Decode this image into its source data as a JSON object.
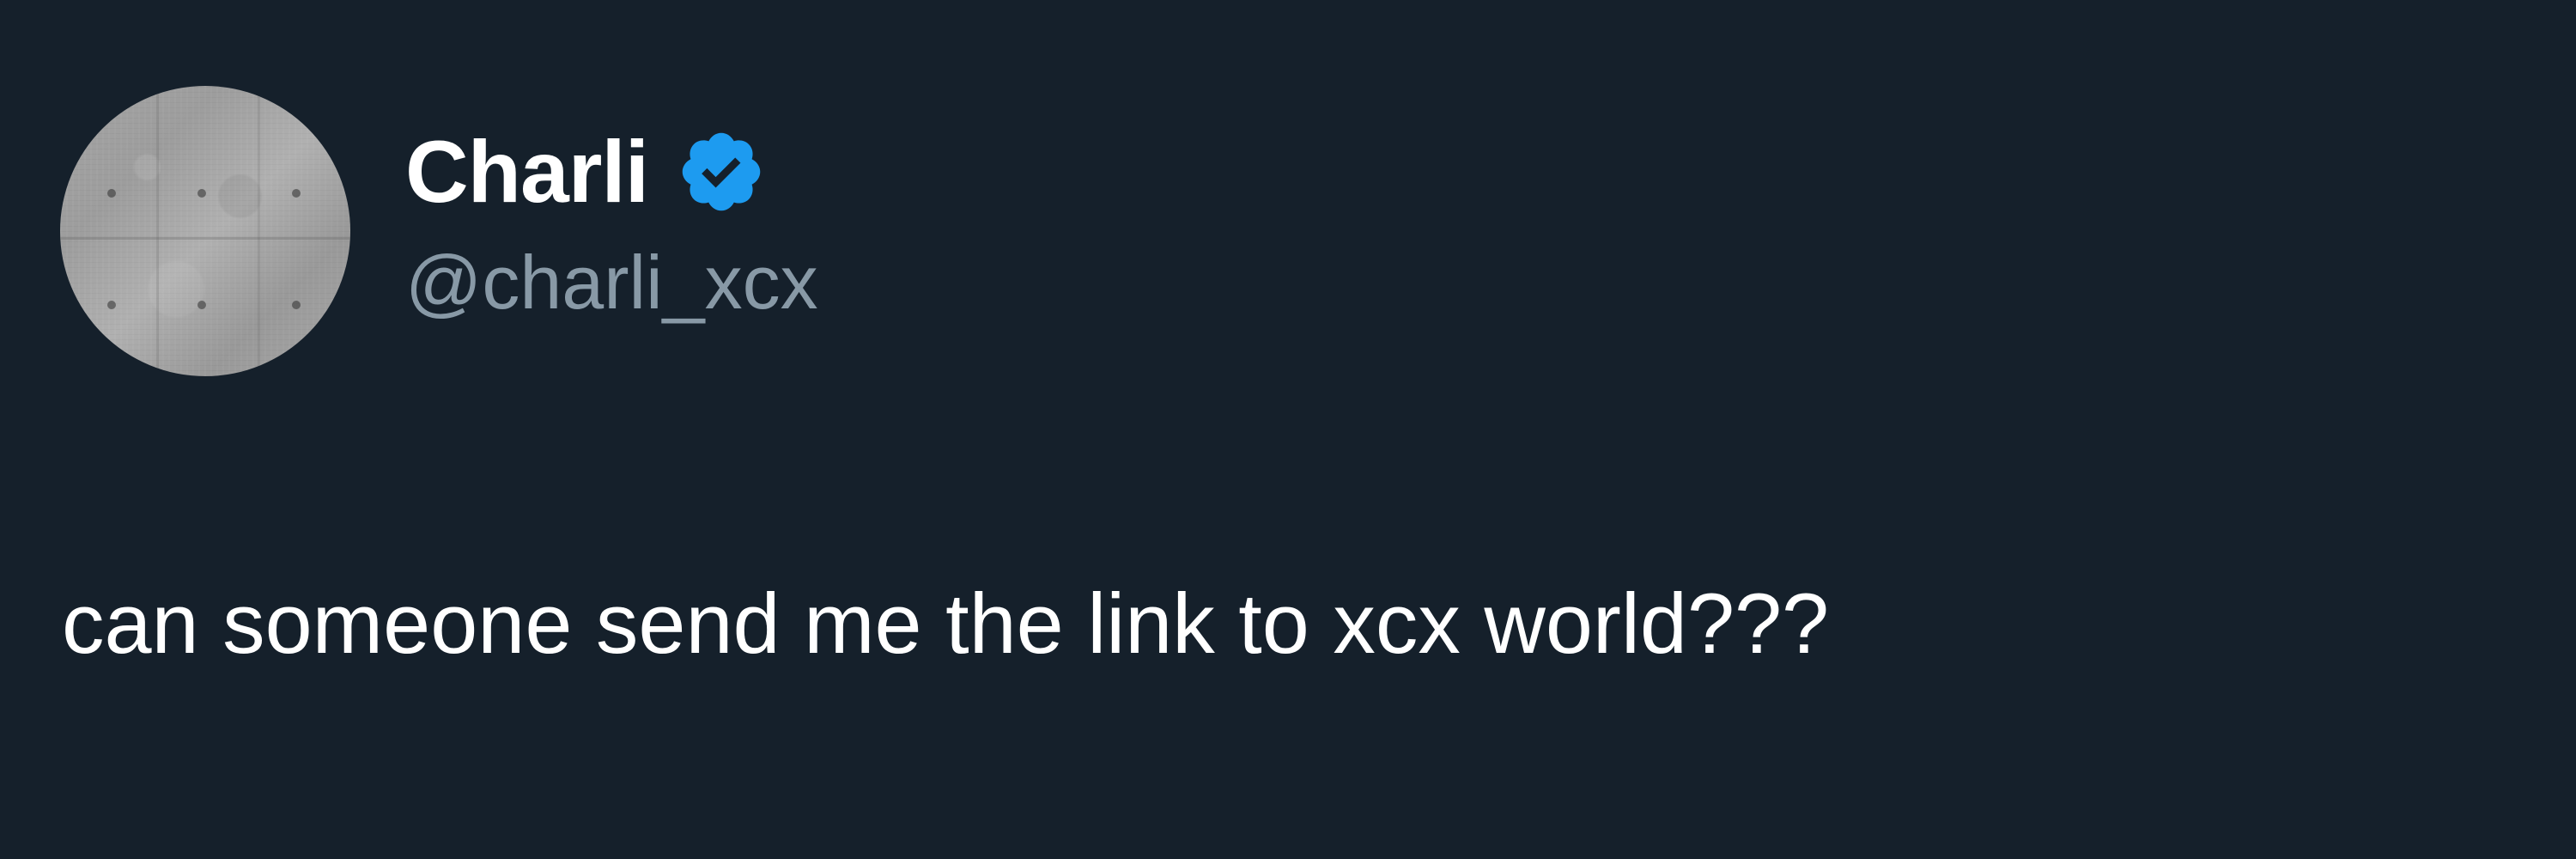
{
  "tweet": {
    "author": {
      "display_name": "Charli",
      "handle": "@charli_xcx",
      "verified": true,
      "verified_icon": "verified-badge-icon"
    },
    "text": "can someone send me the link to xcx world???"
  },
  "colors": {
    "background": "#15202b",
    "display_name": "#ffffff",
    "handle": "#8899a6",
    "tweet_text": "#ffffff",
    "verified_badge": "#1d9bf0"
  }
}
